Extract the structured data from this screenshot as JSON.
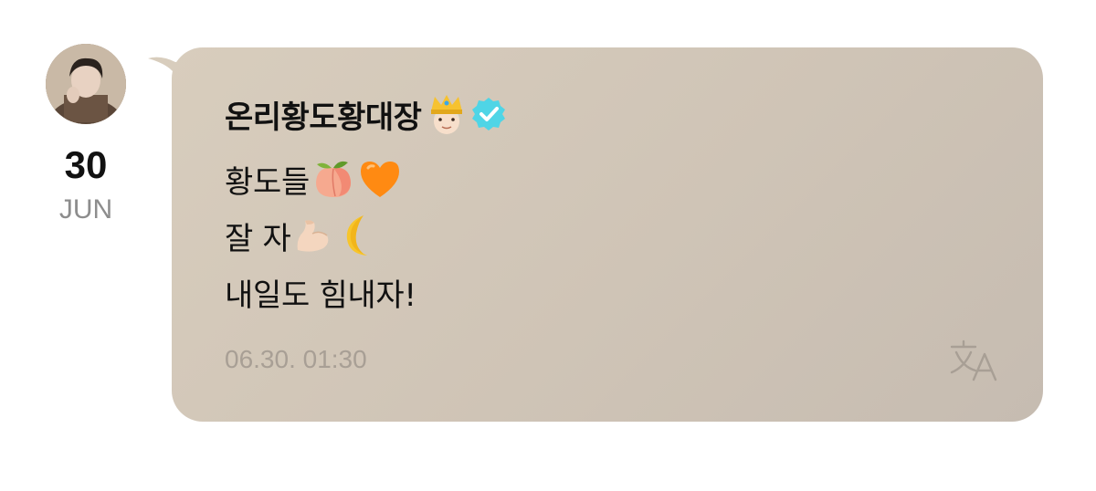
{
  "post": {
    "date_day": "30",
    "date_month": "JUN",
    "sender_name": "온리황도황대장",
    "lines": [
      "황도들",
      "잘 자",
      "내일도 힘내자!"
    ],
    "timestamp": "06.30. 01:30"
  },
  "icons": {
    "crown_emoji": "prince-crown-emoji",
    "verified_badge": "verified-check-icon",
    "peach_emoji": "peach-emoji",
    "heart_emoji": "orange-heart-emoji",
    "flex_emoji": "flexed-biceps-emoji",
    "moon_emoji": "crescent-moon-emoji",
    "translate": "translate-icon"
  },
  "colors": {
    "bubble": "#d3c8b9",
    "verified": "#4fd5e6",
    "timestamp": "#a89f95",
    "month": "#8d8d8d"
  }
}
